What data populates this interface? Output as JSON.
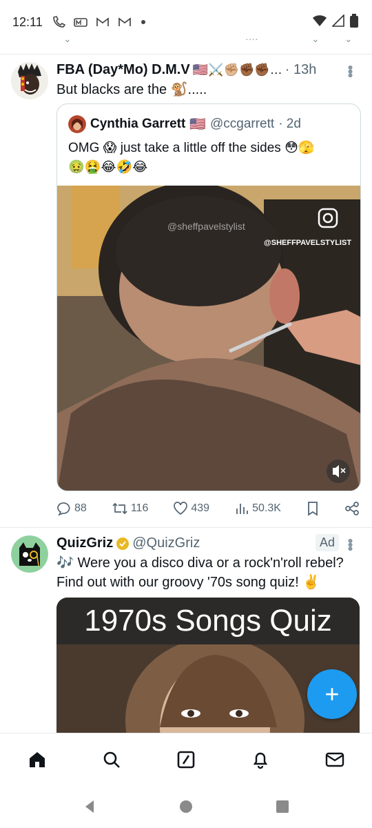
{
  "status_bar": {
    "time": "12:11",
    "notification_icons": [
      "phone-wifi-icon",
      "m-app-icon",
      "gmail-icon",
      "gmail-icon",
      "dot-icon"
    ],
    "right_icons": [
      "wifi-icon",
      "signal-icon",
      "battery-icon"
    ]
  },
  "tweet1": {
    "author_name": "FBA (Day*Mo) D.M.V",
    "author_emojis": "🇺🇸⚔️✊🏼✊🏾✊🏾…",
    "time": "· 13h",
    "text": "But blacks are the 🐒.....",
    "quote": {
      "author_name": "Cynthia Garrett",
      "author_flag": "🇺🇸",
      "handle": "@ccgarrett",
      "time": "· 2d",
      "text_line1": "OMG 😱 just take a little off the sides 😳🫣",
      "text_line2": "🤢🤮😂🤣😂",
      "video_watermark": "@sheffpavelstylist",
      "video_tag": "@SHEFFPAVELSTYLIST"
    },
    "stats": {
      "replies": "88",
      "retweets": "116",
      "likes": "439",
      "views": "50.3K"
    }
  },
  "tweet2": {
    "author_name": "QuizGriz",
    "handle": "@QuizGriz",
    "ad_label": "Ad",
    "text_line1": "🎶 Were you a disco diva or a rock'n'roll rebel?",
    "text_line2": "Find out with our groovy '70s song quiz! ✌️",
    "promo_title": "1970s Songs Quiz"
  },
  "fab": {
    "label": "+"
  },
  "colors": {
    "accent": "#1d9bf0",
    "text": "#0f1419",
    "muted": "#536471",
    "border": "#cfd9de",
    "verified": "#e8b923"
  }
}
